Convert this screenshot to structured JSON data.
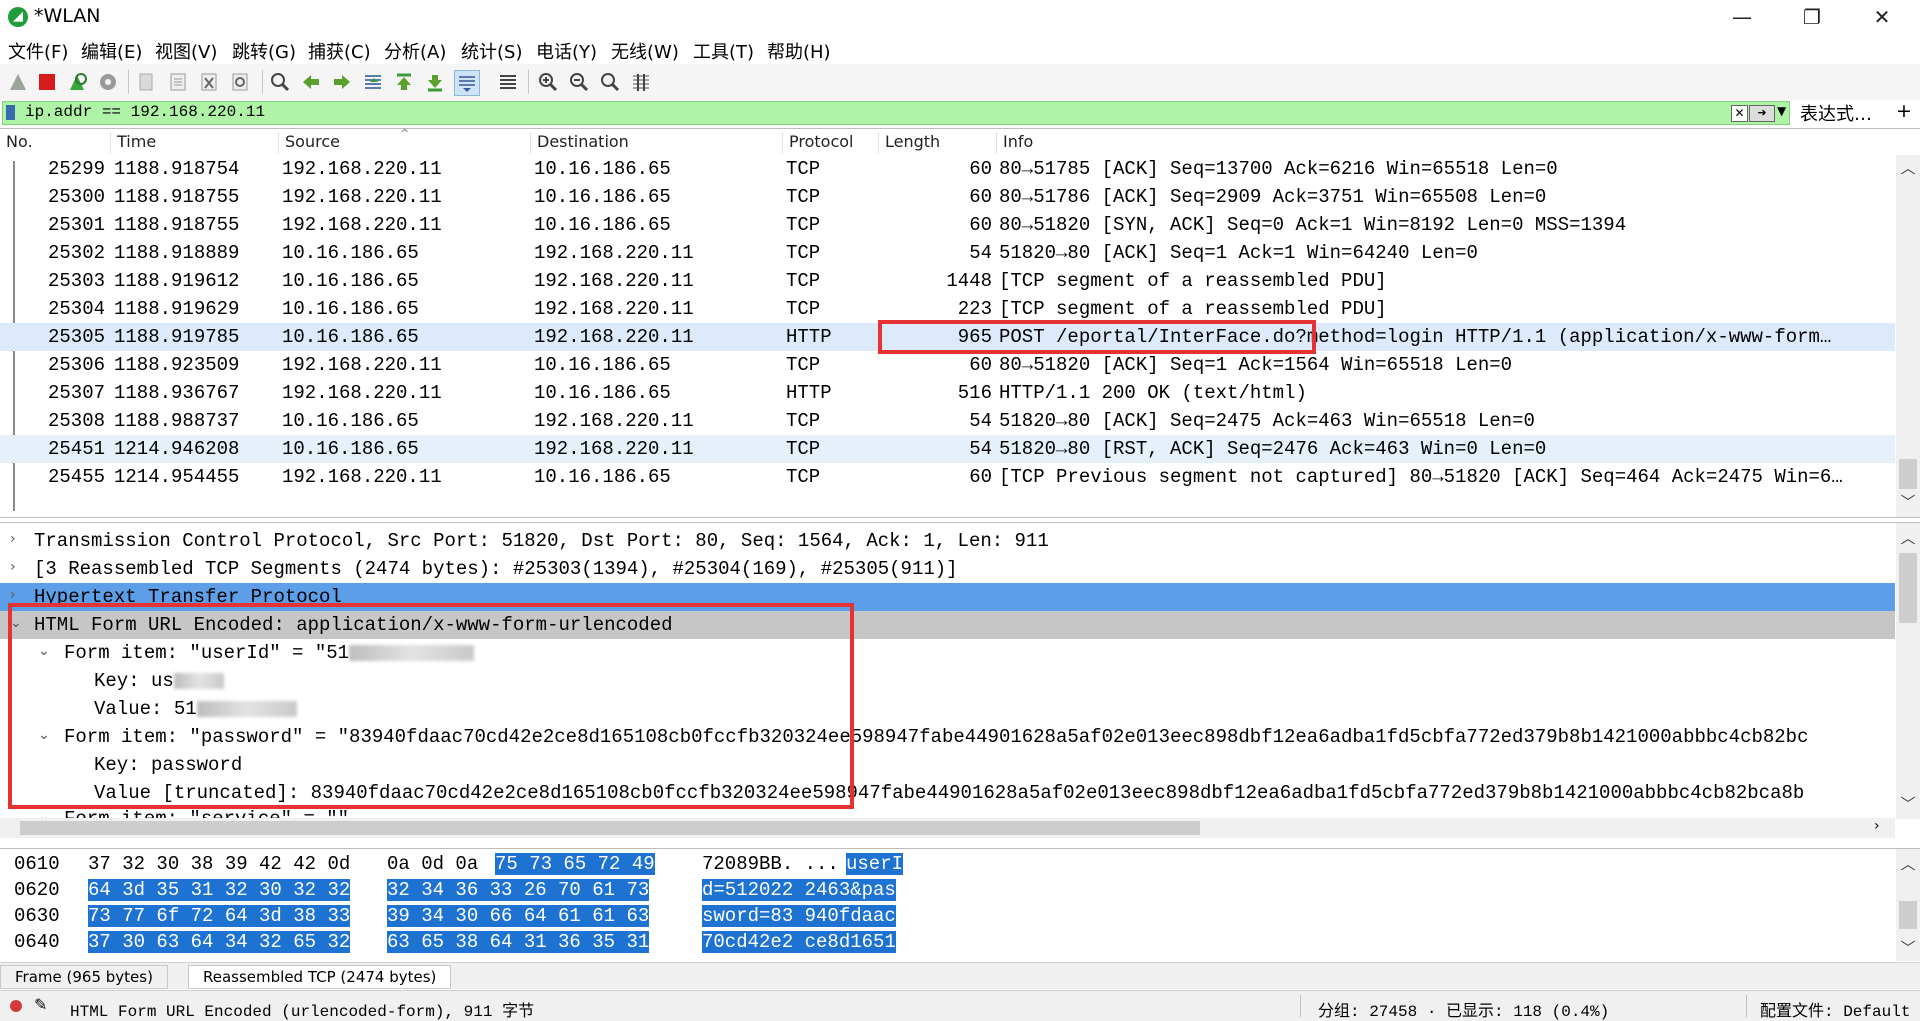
{
  "window": {
    "title": "*WLAN",
    "minimize": "—",
    "maximize": "❐",
    "close": "✕"
  },
  "menu": [
    "文件(F)",
    "编辑(E)",
    "视图(V)",
    "跳转(G)",
    "捕获(C)",
    "分析(A)",
    "统计(S)",
    "电话(Y)",
    "无线(W)",
    "工具(T)",
    "帮助(H)"
  ],
  "filter": {
    "value": "ip.addr == 192.168.220.11",
    "expression_label": "表达式…",
    "plus": "+"
  },
  "packet_list": {
    "columns": [
      "No.",
      "Time",
      "Source",
      "Destination",
      "Protocol",
      "Length",
      "Info"
    ],
    "rows": [
      {
        "no": "25299",
        "time": "1188.918754",
        "src": "192.168.220.11",
        "dst": "10.16.186.65",
        "proto": "TCP",
        "len": "60",
        "info": "80→51785 [ACK] Seq=13700 Ack=6216 Win=65518 Len=0"
      },
      {
        "no": "25300",
        "time": "1188.918755",
        "src": "192.168.220.11",
        "dst": "10.16.186.65",
        "proto": "TCP",
        "len": "60",
        "info": "80→51786 [ACK] Seq=2909 Ack=3751 Win=65508 Len=0"
      },
      {
        "no": "25301",
        "time": "1188.918755",
        "src": "192.168.220.11",
        "dst": "10.16.186.65",
        "proto": "TCP",
        "len": "60",
        "info": "80→51820 [SYN, ACK] Seq=0 Ack=1 Win=8192 Len=0 MSS=1394"
      },
      {
        "no": "25302",
        "time": "1188.918889",
        "src": "10.16.186.65",
        "dst": "192.168.220.11",
        "proto": "TCP",
        "len": "54",
        "info": "51820→80 [ACK] Seq=1 Ack=1 Win=64240 Len=0"
      },
      {
        "no": "25303",
        "time": "1188.919612",
        "src": "10.16.186.65",
        "dst": "192.168.220.11",
        "proto": "TCP",
        "len": "1448",
        "info": "[TCP segment of a reassembled PDU]"
      },
      {
        "no": "25304",
        "time": "1188.919629",
        "src": "10.16.186.65",
        "dst": "192.168.220.11",
        "proto": "TCP",
        "len": "223",
        "info": "[TCP segment of a reassembled PDU]"
      },
      {
        "no": "25305",
        "time": "1188.919785",
        "src": "10.16.186.65",
        "dst": "192.168.220.11",
        "proto": "HTTP",
        "len": "965",
        "info": "POST /eportal/InterFace.do?method=login HTTP/1.1  (application/x-www-form…"
      },
      {
        "no": "25306",
        "time": "1188.923509",
        "src": "192.168.220.11",
        "dst": "10.16.186.65",
        "proto": "TCP",
        "len": "60",
        "info": "80→51820 [ACK] Seq=1 Ack=1564 Win=65518 Len=0"
      },
      {
        "no": "25307",
        "time": "1188.936767",
        "src": "192.168.220.11",
        "dst": "10.16.186.65",
        "proto": "HTTP",
        "len": "516",
        "info": "HTTP/1.1 200 OK  (text/html)"
      },
      {
        "no": "25308",
        "time": "1188.988737",
        "src": "10.16.186.65",
        "dst": "192.168.220.11",
        "proto": "TCP",
        "len": "54",
        "info": "51820→80 [ACK] Seq=2475 Ack=463 Win=65518 Len=0"
      },
      {
        "no": "25451",
        "time": "1214.946208",
        "src": "10.16.186.65",
        "dst": "192.168.220.11",
        "proto": "TCP",
        "len": "54",
        "info": "51820→80 [RST, ACK] Seq=2476 Ack=463 Win=0 Len=0"
      },
      {
        "no": "25455",
        "time": "1214.954455",
        "src": "192.168.220.11",
        "dst": "10.16.186.65",
        "proto": "TCP",
        "len": "60",
        "info": "[TCP Previous segment not captured] 80→51820 [ACK] Seq=464 Ack=2475 Win=6…"
      }
    ]
  },
  "details": [
    "Transmission Control Protocol, Src Port: 51820, Dst Port: 80, Seq: 1564, Ack: 1, Len: 911",
    "[3 Reassembled TCP Segments (2474 bytes): #25303(1394), #25304(169), #25305(911)]",
    "Hypertext Transfer Protocol",
    "HTML Form URL Encoded: application/x-www-form-urlencoded",
    "Form item: \"userId\" = \"51",
    "Key: us",
    "Value: 51",
    "Form item: \"password\" = \"83940fdaac70cd42e2ce8d165108cb0fccfb320324ee598947fabe44901628a5af02e013eec898dbf12ea6adba1fd5cbfa772ed379b8b1421000abbbc4cb82bc",
    "Key: password",
    "Value [truncated]: 83940fdaac70cd42e2ce8d165108cb0fccfb320324ee598947fabe44901628a5af02e013eec898dbf12ea6adba1fd5cbfa772ed379b8b1421000abbbc4cb82bca8b",
    "Form item: \"service\" = \"\""
  ],
  "bytes": [
    {
      "offset": "0610",
      "hex1": "37 32 30 38 39 42 42 0d",
      "hex2a": "0a 0d 0a",
      "hex2b": "75 73 65 72 49",
      "ascii_a": "72089BB. ...",
      "ascii_b": "userI"
    },
    {
      "offset": "0620",
      "hex1": "64 3d 35 31 32 30 32 32",
      "hex2b": "32 34 36 33 26 70 61 73",
      "ascii_b": "d=512022 2463&pas"
    },
    {
      "offset": "0630",
      "hex1": "73 77 6f 72 64 3d 38 33",
      "hex2b": "39 34 30 66 64 61 61 63",
      "ascii_b": "sword=83 940fdaac"
    },
    {
      "offset": "0640",
      "hex1": "37 30 63 64 34 32 65 32",
      "hex2b": "63 65 38 64 31 36 35 31",
      "ascii_b": "70cd42e2 ce8d1651"
    }
  ],
  "byte_tabs": [
    "Frame (965 bytes)",
    "Reassembled TCP (2474 bytes)"
  ],
  "status": {
    "field": "HTML Form URL Encoded (urlencoded-form), 911 字节",
    "counts": "分组: 27458 · 已显示: 118 (0.4%)",
    "profile": "配置文件: Default"
  },
  "colors": {
    "selected_row": "#ddeafb",
    "detail_selected": "#5d9ee8",
    "hex_selected": "#1e73d2",
    "filter_ok": "#aff3a7",
    "highlight": "#e53232"
  }
}
